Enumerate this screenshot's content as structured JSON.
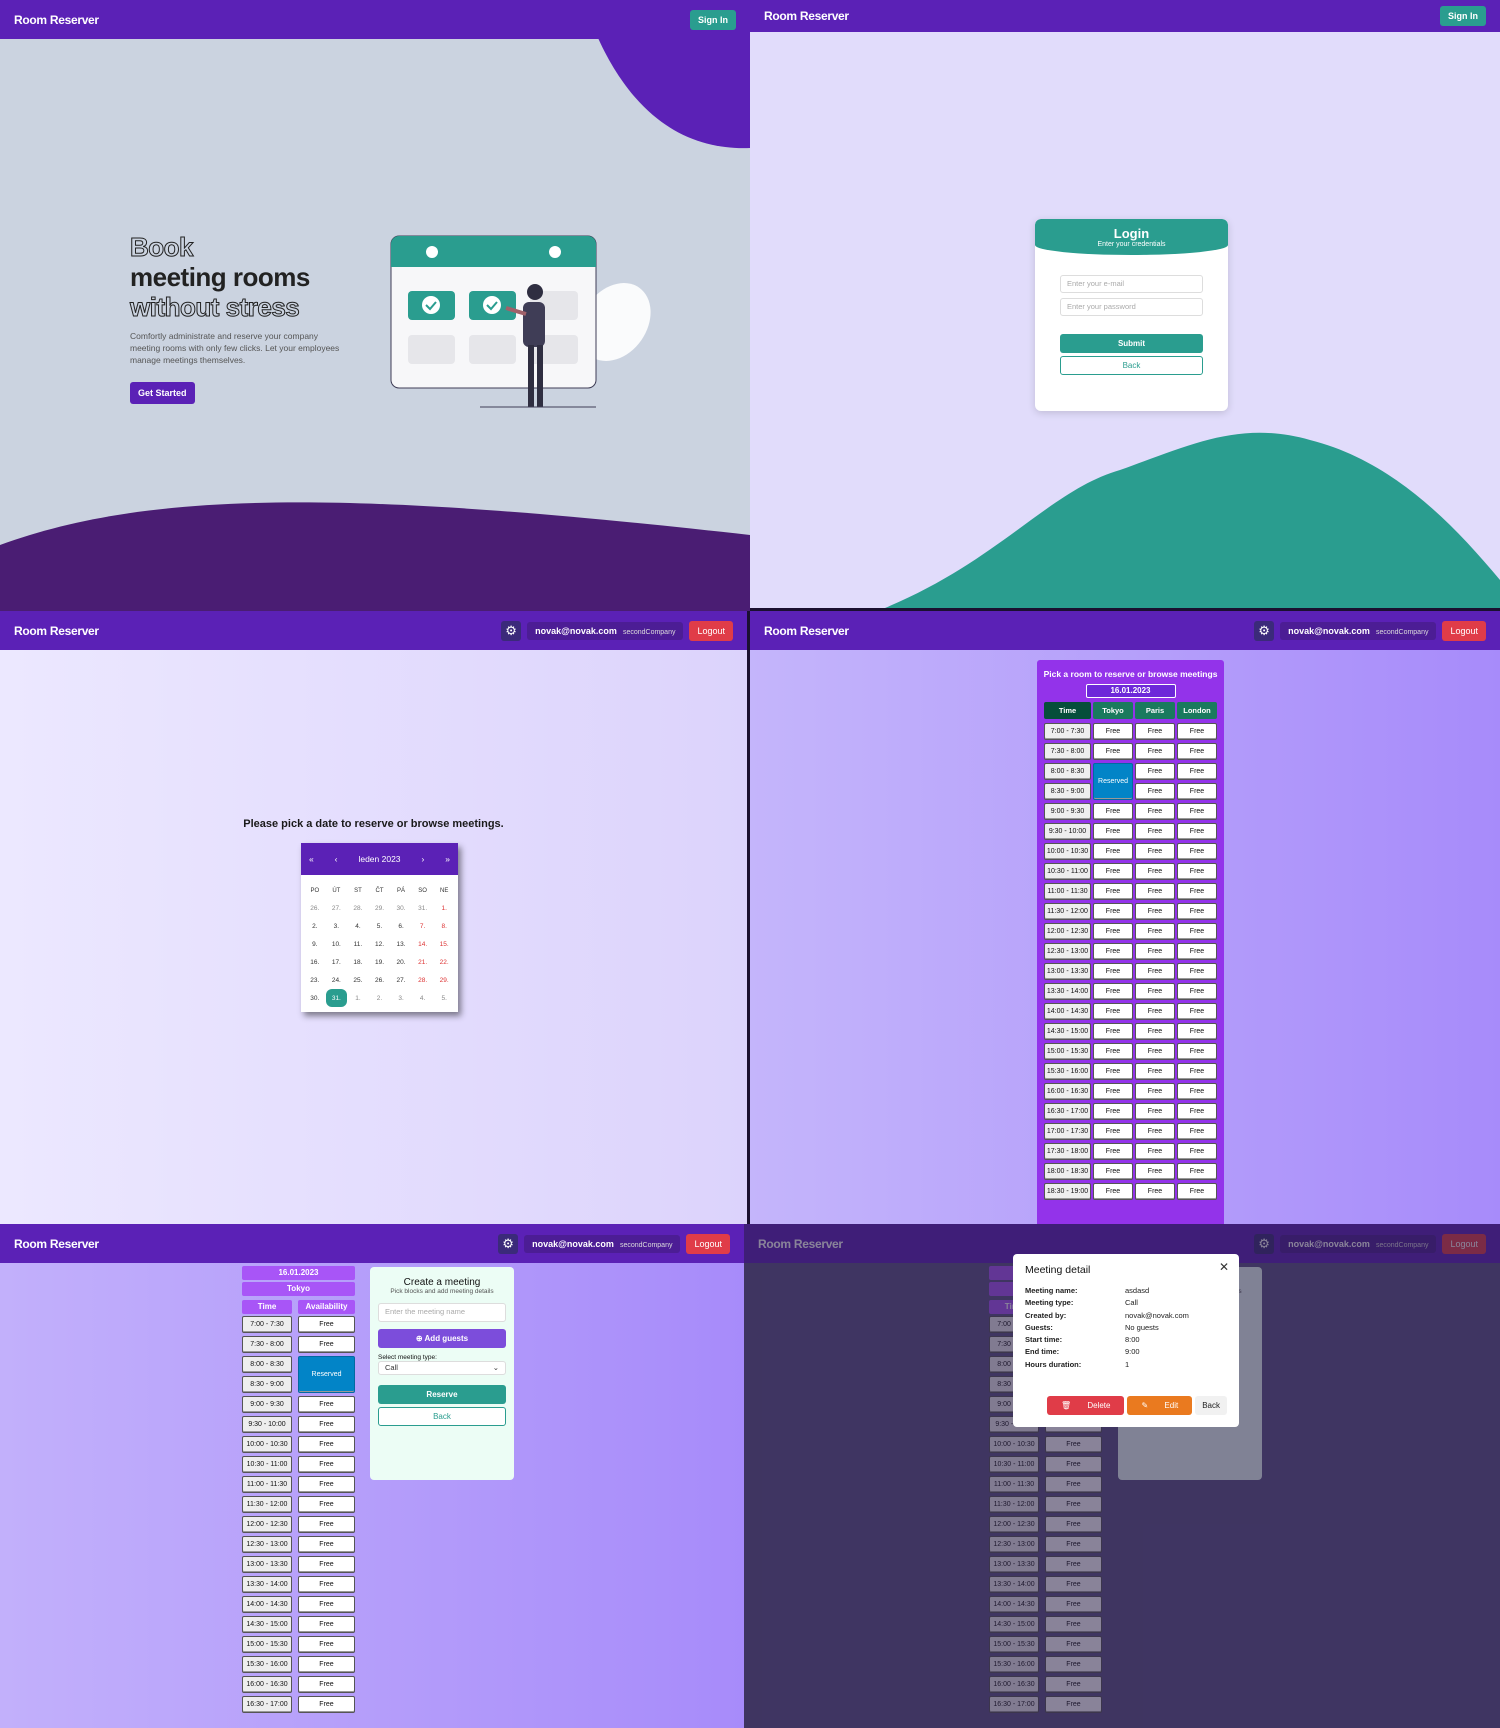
{
  "app": {
    "brand": "Room Reserver",
    "sign_in": "Sign In",
    "logout": "Logout",
    "user_email": "novak@novak.com",
    "user_company": "secondCompany"
  },
  "landing": {
    "title_1": "Book",
    "title_2": "meeting rooms",
    "title_3": "without stress",
    "description": "Comfortly administrate and reserve your company meeting rooms with only few clicks. Let your employees manage meetings themselves.",
    "cta": "Get Started"
  },
  "login": {
    "title": "Login",
    "subtitle": "Enter your credentials",
    "email_placeholder": "Enter your e-mail",
    "password_placeholder": "Enter your password",
    "submit": "Submit",
    "back": "Back"
  },
  "calendar": {
    "prompt": "Please pick a date to reserve or browse meetings.",
    "month_label": "leden 2023",
    "nav": [
      "«",
      "‹",
      "›",
      "»"
    ],
    "weekdays": [
      "PO",
      "ÚT",
      "ST",
      "ČT",
      "PÁ",
      "SO",
      "NE"
    ],
    "weeks": [
      [
        "26.",
        "27.",
        "28.",
        "29.",
        "30.",
        "31.",
        "1."
      ],
      [
        "2.",
        "3.",
        "4.",
        "5.",
        "6.",
        "7.",
        "8."
      ],
      [
        "9.",
        "10.",
        "11.",
        "12.",
        "13.",
        "14.",
        "15."
      ],
      [
        "16.",
        "17.",
        "18.",
        "19.",
        "20.",
        "21.",
        "22."
      ],
      [
        "23.",
        "24.",
        "25.",
        "26.",
        "27.",
        "28.",
        "29."
      ],
      [
        "30.",
        "31.",
        "1.",
        "2.",
        "3.",
        "4.",
        "5."
      ]
    ],
    "selected": "31."
  },
  "schedule": {
    "title": "Pick a room to reserve or browse meetings",
    "date": "16.01.2023",
    "columns": [
      "Time",
      "Tokyo",
      "Paris",
      "London"
    ],
    "times": [
      "7:00 - 7:30",
      "7:30 - 8:00",
      "8:00 - 8:30",
      "8:30 - 9:00",
      "9:00 - 9:30",
      "9:30 - 10:00",
      "10:00 - 10:30",
      "10:30 - 11:00",
      "11:00 - 11:30",
      "11:30 - 12:00",
      "12:00 - 12:30",
      "12:30 - 13:00",
      "13:00 - 13:30",
      "13:30 - 14:00",
      "14:00 - 14:30",
      "14:30 - 15:00",
      "15:00 - 15:30",
      "15:30 - 16:00",
      "16:00 - 16:30",
      "16:30 - 17:00",
      "17:00 - 17:30",
      "17:30 - 18:00",
      "18:00 - 18:30",
      "18:30 - 19:00"
    ],
    "free": "Free",
    "reserved": "Reserved"
  },
  "room_view": {
    "date": "16.01.2023",
    "room": "Tokyo",
    "col_time": "Time",
    "col_avail": "Availability"
  },
  "create_meeting": {
    "title": "Create a meeting",
    "subtitle": "Pick blocks and add meeting details",
    "name_placeholder": "Enter the meeting name",
    "add_guests": "Add guests",
    "type_label": "Select meeting type:",
    "type_value": "Call",
    "reserve": "Reserve",
    "back": "Back"
  },
  "meeting_detail": {
    "title": "Meeting detail",
    "rows": [
      {
        "k": "Meeting name:",
        "v": "asdasd"
      },
      {
        "k": "Meeting type:",
        "v": "Call"
      },
      {
        "k": "Created by:",
        "v": "novak@novak.com"
      },
      {
        "k": "Guests:",
        "v": "No guests"
      },
      {
        "k": "Start time:",
        "v": "8:00"
      },
      {
        "k": "End time:",
        "v": "9:00"
      },
      {
        "k": "Hours duration:",
        "v": "1"
      }
    ],
    "delete": "Delete",
    "edit": "Edit",
    "back": "Back"
  },
  "colors": {
    "primary": "#5b21b6",
    "teal": "#2a9d8f",
    "reserved": "#0284c7",
    "danger": "#e03c48",
    "edit": "#ea7a1f"
  }
}
